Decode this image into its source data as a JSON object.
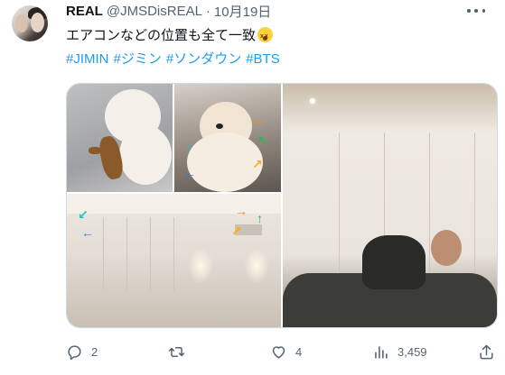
{
  "tweet": {
    "author_name": "REAL",
    "handle": "@JMSDisREAL",
    "separator": "·",
    "date": "10月19日",
    "text": "エアコンなどの位置も全て一致",
    "emoji": "dizzy-face-emoji",
    "hashtags": [
      "#JIMIN",
      "#ジミン",
      "#ソンダウン",
      "#BTS"
    ]
  },
  "media": {
    "images": [
      {
        "name": "puppy-with-toy"
      },
      {
        "name": "pomeranian-with-arrows"
      },
      {
        "name": "room-with-arrows"
      },
      {
        "name": "person-on-sofa"
      }
    ]
  },
  "actions": {
    "reply": {
      "icon": "reply-icon",
      "count": "2"
    },
    "repost": {
      "icon": "repost-icon",
      "count": ""
    },
    "like": {
      "icon": "heart-icon",
      "count": "4"
    },
    "views": {
      "icon": "views-icon",
      "count": "3,459"
    },
    "share": {
      "icon": "share-icon"
    }
  },
  "colors": {
    "link": "#1d9bf0",
    "muted": "#536471",
    "text": "#0f1419",
    "border": "#cfd9de"
  }
}
